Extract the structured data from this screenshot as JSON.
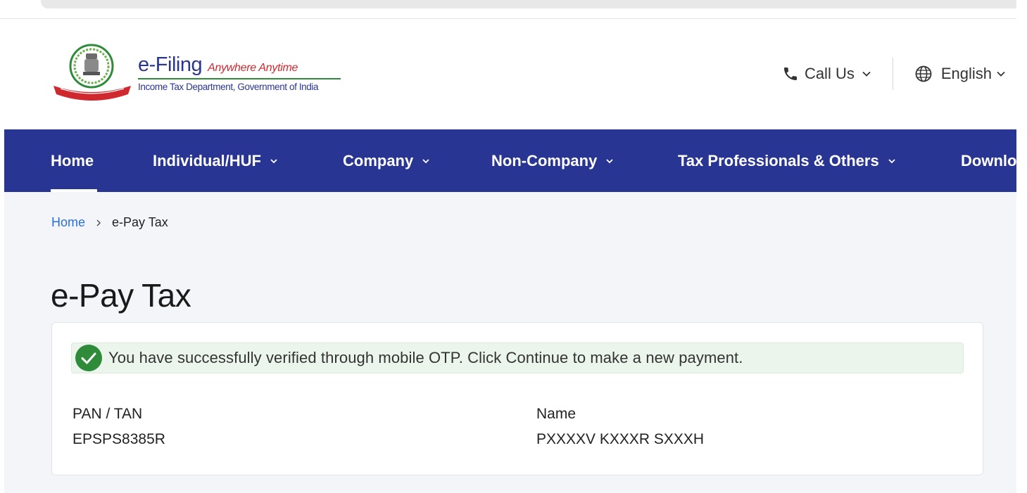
{
  "header": {
    "brand_name": "e-Filing",
    "brand_tagline": "Anywhere Anytime",
    "brand_subtitle": "Income Tax Department, Government of India",
    "call_us_label": "Call Us",
    "language_label": "English"
  },
  "nav": {
    "items": [
      {
        "label": "Home",
        "active": true
      },
      {
        "label": "Individual/HUF"
      },
      {
        "label": "Company"
      },
      {
        "label": "Non-Company"
      },
      {
        "label": "Tax Professionals & Others"
      },
      {
        "label": "Downlo"
      }
    ]
  },
  "breadcrumb": {
    "home": "Home",
    "current": "e-Pay Tax"
  },
  "page": {
    "title": "e-Pay Tax"
  },
  "alert": {
    "message": "You have successfully verified through mobile OTP. Click Continue to make a new payment."
  },
  "details": {
    "pan_label": "PAN / TAN",
    "pan_value": "EPSPS8385R",
    "name_label": "Name",
    "name_value": "PXXXXV KXXXR SXXXH"
  },
  "colors": {
    "nav_background": "#283593",
    "link": "#2a6fd1",
    "success": "#2e8b3a",
    "brand_red": "#d0282f"
  }
}
